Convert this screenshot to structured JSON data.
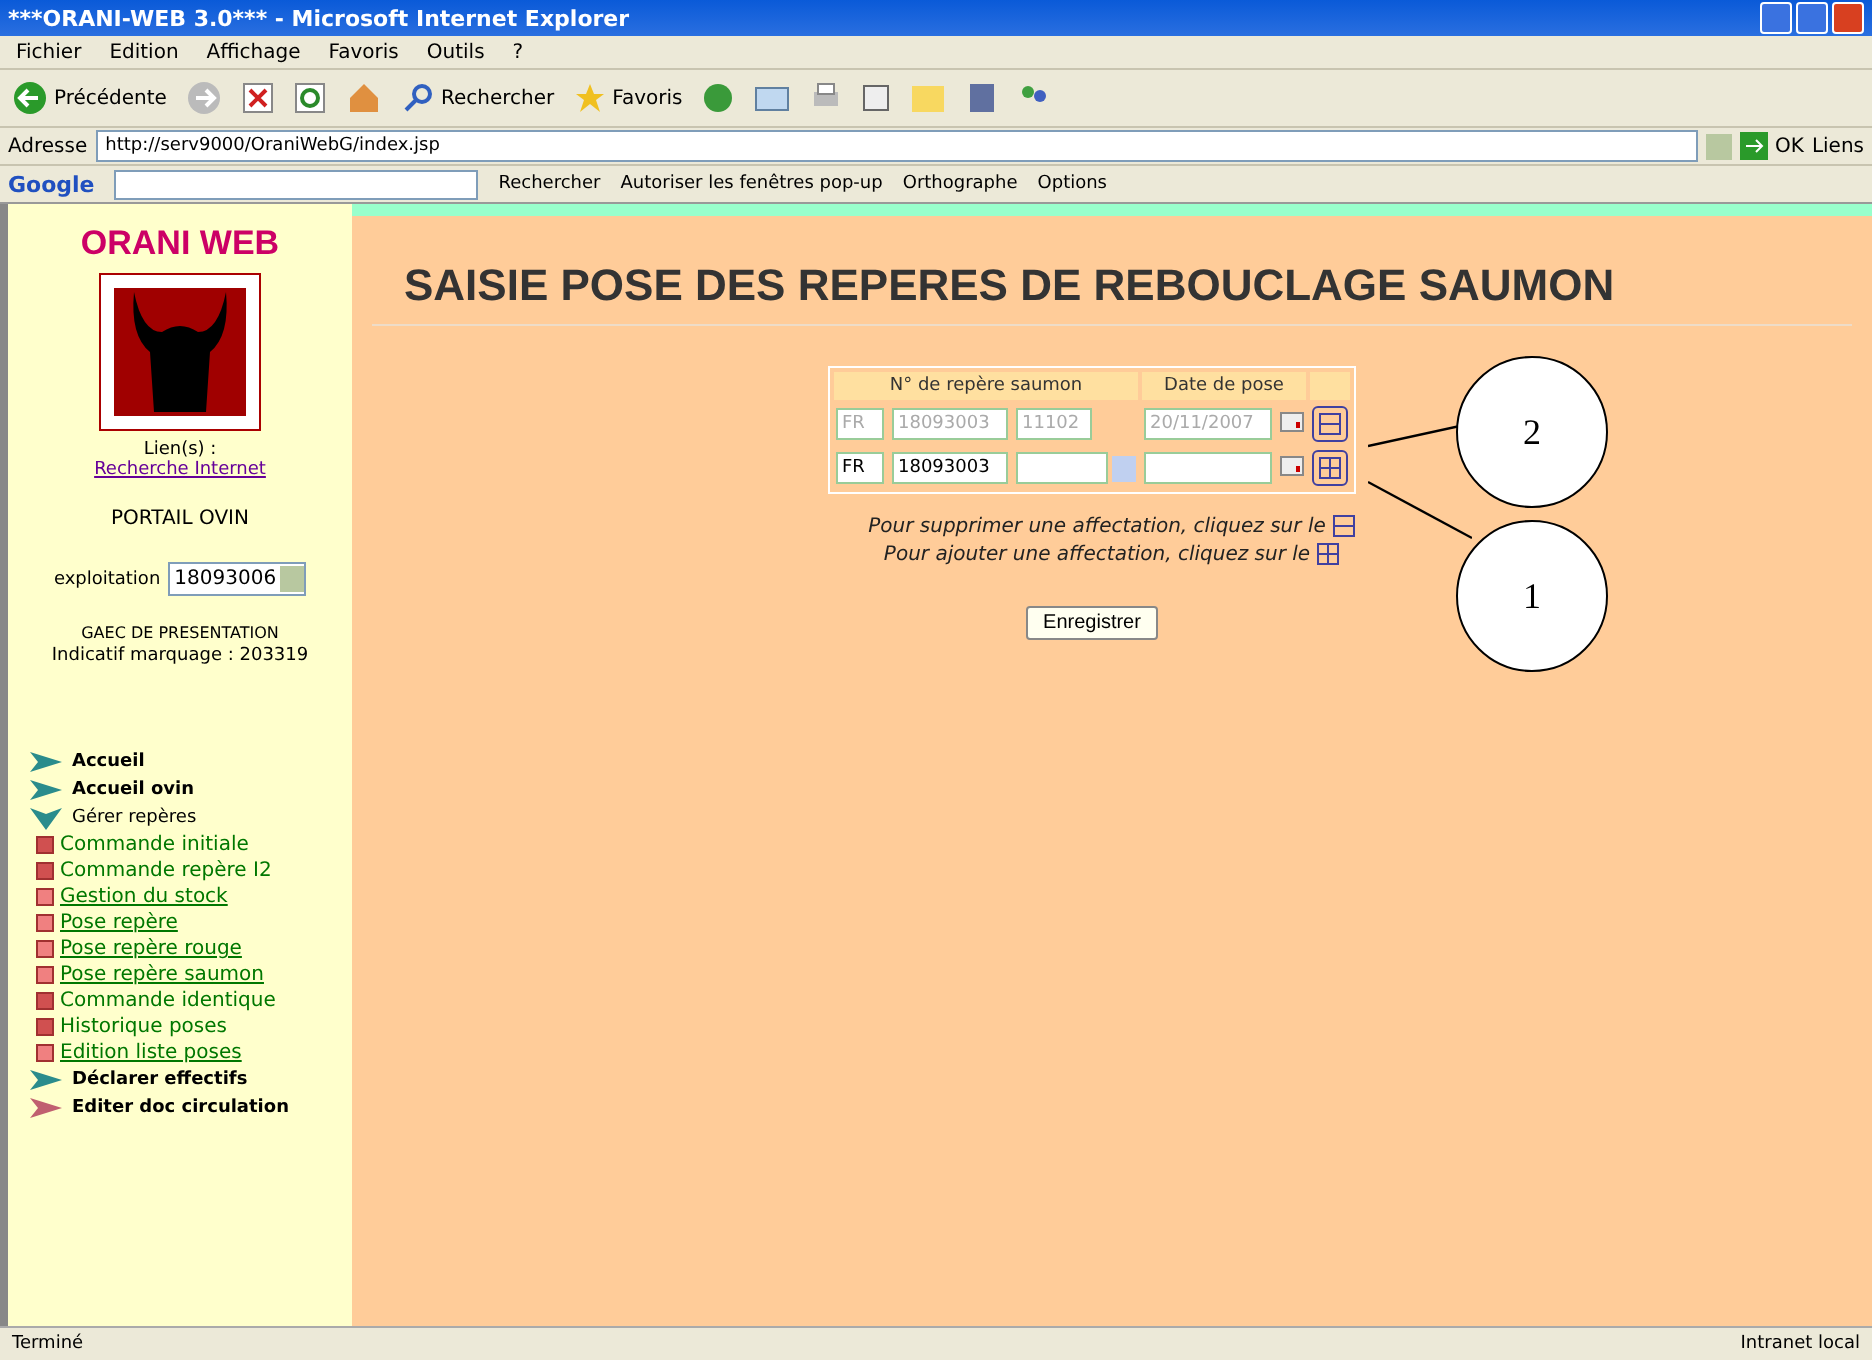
{
  "window": {
    "title": "***ORANI-WEB 3.0*** - Microsoft Internet Explorer"
  },
  "menu": [
    "Fichier",
    "Edition",
    "Affichage",
    "Favoris",
    "Outils",
    "?"
  ],
  "toolbar": {
    "back": "Précédente",
    "search": "Rechercher",
    "favorites": "Favoris"
  },
  "address": {
    "label": "Adresse",
    "value": "http://serv9000/OraniWebG/index.jsp",
    "go": "OK",
    "links": "Liens"
  },
  "google_bar": {
    "logo": "Google",
    "search": "Rechercher",
    "popups": "Autoriser les fenêtres pop-up",
    "spelling": "Orthographe",
    "options": "Options"
  },
  "sidebar": {
    "brand": "ORANI WEB",
    "links_label": "Lien(s) :",
    "search_link": "Recherche Internet",
    "portal": "PORTAIL OVIN",
    "farm_label": "exploitation",
    "farm_value": "18093006",
    "owner": "GAEC DE PRESENTATION",
    "marking": "Indicatif marquage : 203319",
    "nav": [
      {
        "label": "Accueil",
        "expanded": false,
        "color": "#2a8c8c"
      },
      {
        "label": "Accueil ovin",
        "expanded": false,
        "color": "#2a8c8c"
      },
      {
        "label": "Gérer repères",
        "expanded": true,
        "color": "#2a8c8c",
        "children": [
          {
            "label": "Commande initiale",
            "link": false
          },
          {
            "label": "Commande repère I2",
            "link": false
          },
          {
            "label": "Gestion du stock",
            "link": true
          },
          {
            "label": "Pose repère",
            "link": true
          },
          {
            "label": "Pose repère rouge",
            "link": true
          },
          {
            "label": "Pose repère saumon",
            "link": true
          },
          {
            "label": "Commande identique",
            "link": false
          },
          {
            "label": "Historique poses",
            "link": false
          },
          {
            "label": "Edition liste poses",
            "link": true
          }
        ]
      },
      {
        "label": "Déclarer effectifs",
        "expanded": false,
        "color": "#2a8c8c"
      },
      {
        "label": "Editer doc circulation",
        "expanded": false,
        "color": "#c06070"
      }
    ]
  },
  "page": {
    "title": "SAISIE POSE DES REPERES DE REBOUCLAGE SAUMON",
    "columns": [
      "N° de repère saumon",
      "Date de pose"
    ],
    "rows": [
      {
        "country": "FR",
        "farm": "18093003",
        "number": "11102",
        "date": "20/11/2007",
        "disabled": true,
        "kind": "remove"
      },
      {
        "country": "FR",
        "farm": "18093003",
        "number": "",
        "date": "",
        "disabled": false,
        "kind": "add"
      }
    ],
    "hints": [
      {
        "text": "Pour supprimer une affectation, cliquez sur le",
        "kind": "remove"
      },
      {
        "text": "Pour ajouter une affectation, cliquez sur le",
        "kind": "add"
      }
    ],
    "save": "Enregistrer",
    "callouts": [
      "2",
      "1"
    ]
  },
  "status_bar": {
    "left": "Terminé",
    "zone": "Intranet local"
  }
}
